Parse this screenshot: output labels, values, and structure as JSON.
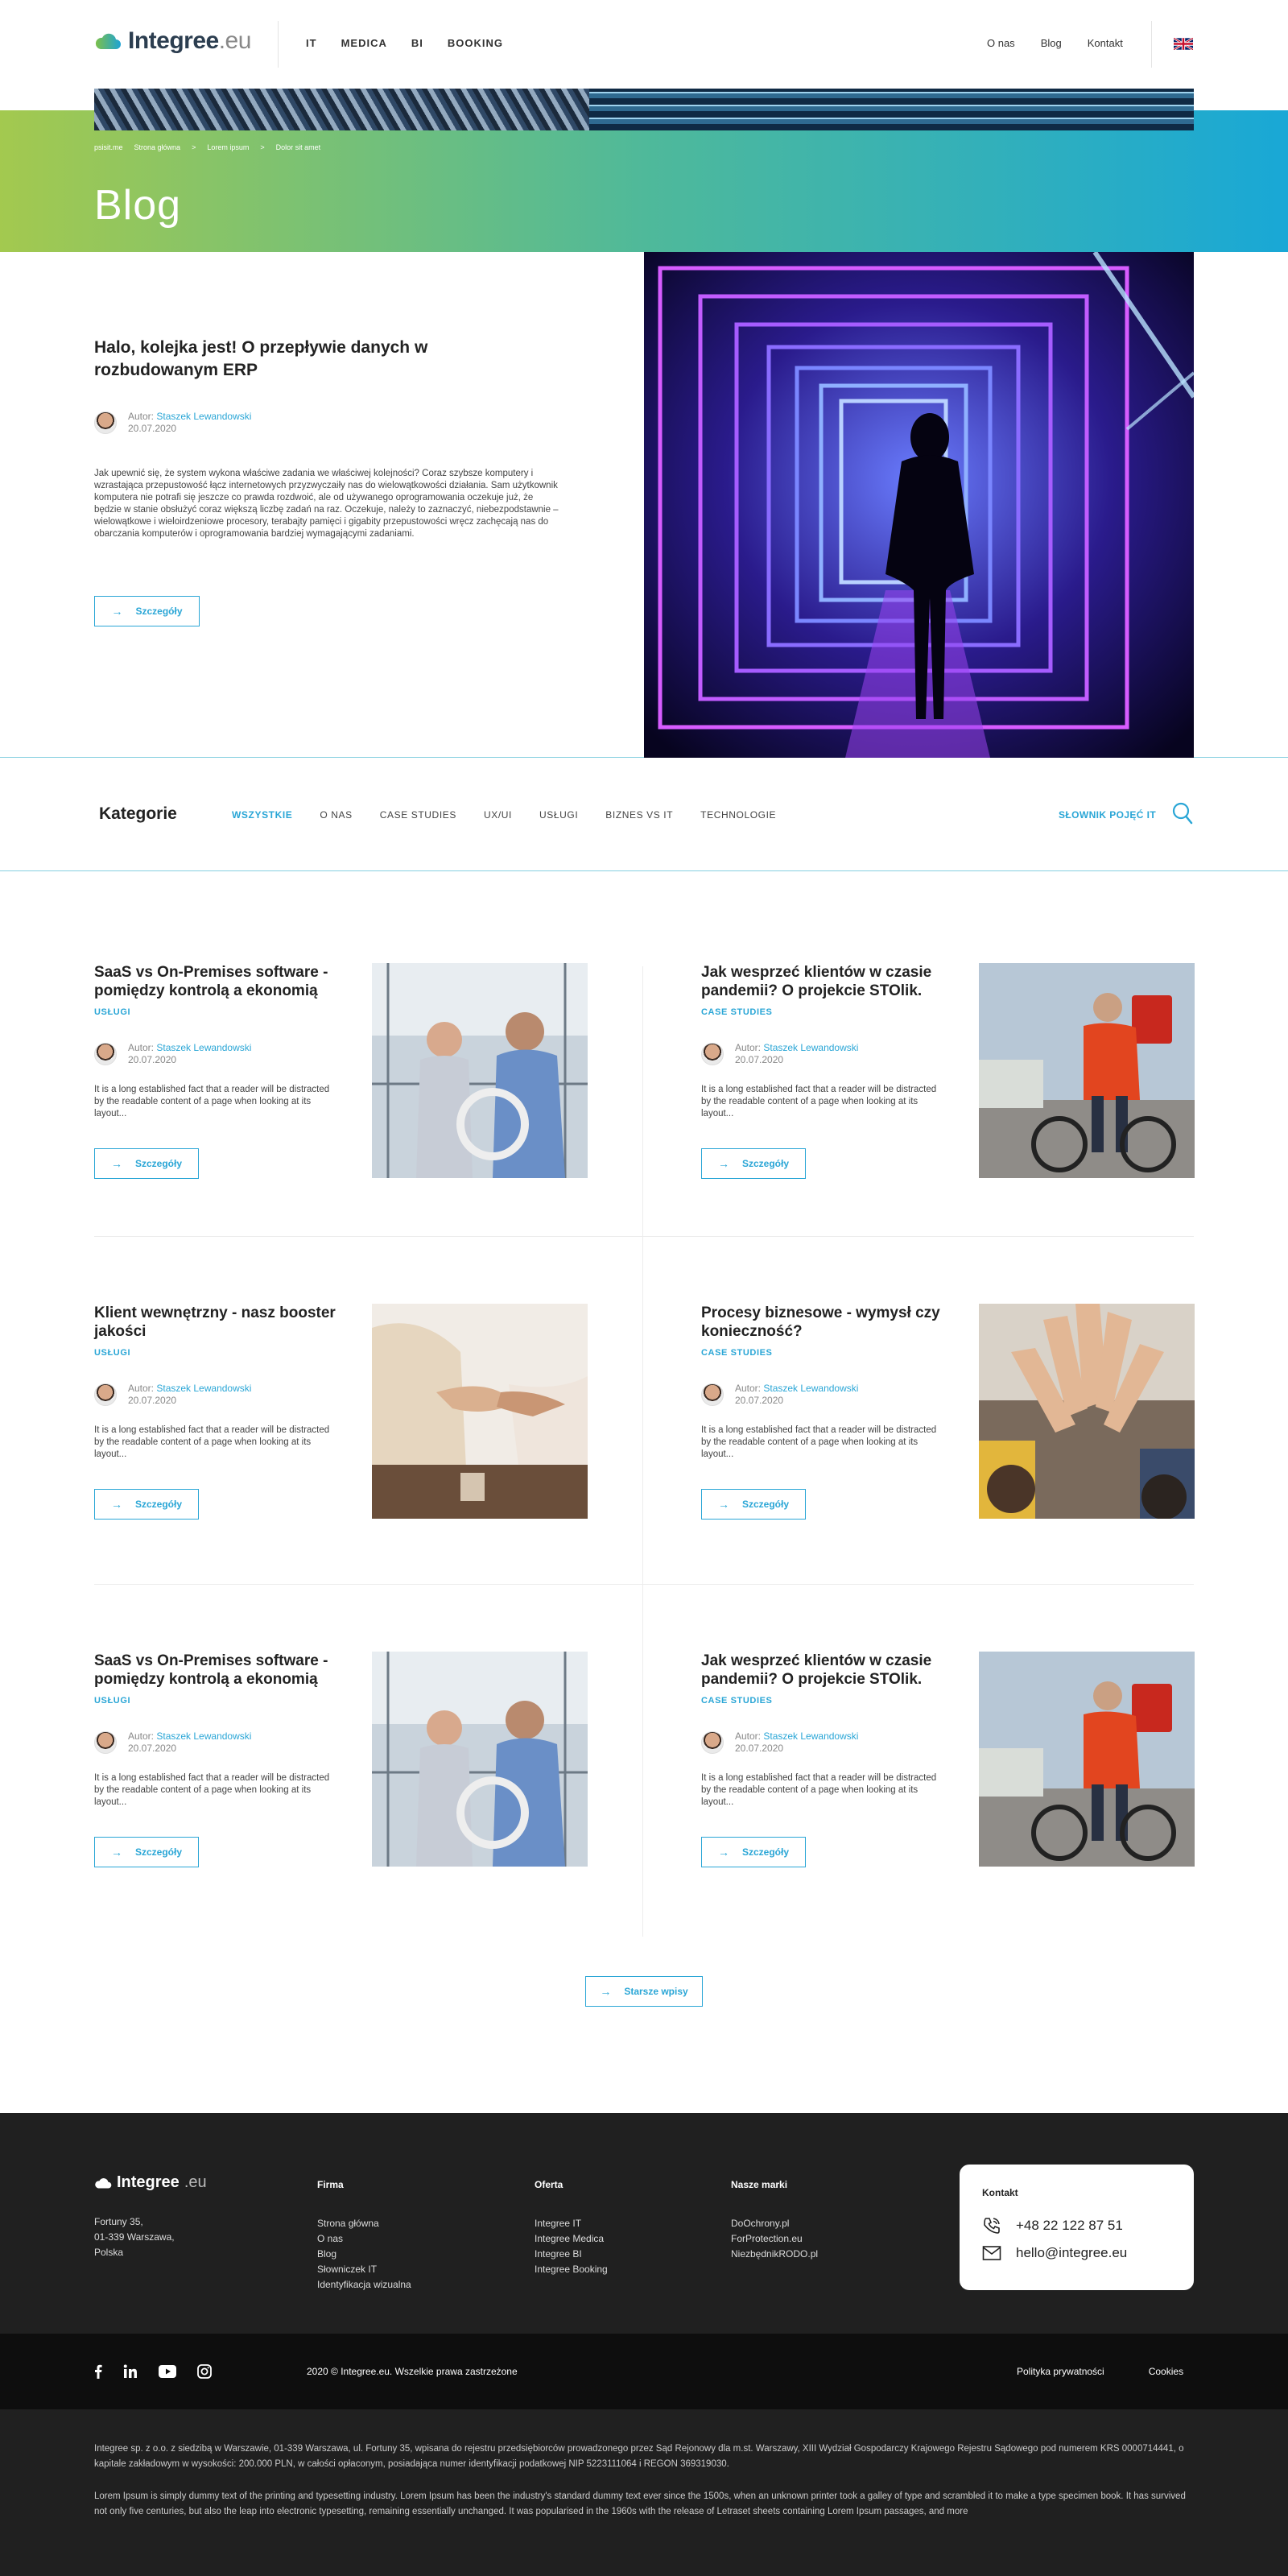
{
  "header": {
    "logo_brand": "Integree",
    "logo_tld": ".eu",
    "nav_main": [
      "IT",
      "MEDICA",
      "BI",
      "BOOKING"
    ],
    "nav_secondary": [
      "O nas",
      "Blog",
      "Kontakt"
    ],
    "language_icon": "uk-flag-icon"
  },
  "hero": {
    "breadcrumb": [
      "psisit.me",
      "Strona główna",
      ">",
      "Lorem ipsum",
      ">",
      "Dolor sit amet"
    ],
    "title": "Blog"
  },
  "featured": {
    "title": "Halo, kolejka jest! O przepływie danych w rozbudowanym ERP",
    "author_label": "Autor:",
    "author_name": "Staszek Lewandowski",
    "date": "20.07.2020",
    "excerpt": "Jak upewnić się, że system wykona właściwe zadania we właściwej kolejności? Coraz szybsze komputery i wzrastająca przepustowość łącz internetowych przyzwyczaiły nas do wielowątkowości działania. Sam użytkownik komputera nie potrafi się jeszcze co prawda rozdwoić, ale od używanego oprogramowania oczekuje już, że będzie w stanie obsłużyć coraz większą liczbę zadań na raz. Oczekuje, należy to zaznaczyć, niebezpodstawnie – wielowątkowe i wieloirdzeniowe procesory, terabajty pamięci i gigabity przepustowości wręcz zachęcają nas do obarczania komputerów i oprogramowania bardziej wymagającymi zadaniami.",
    "button": "Szczegóły"
  },
  "categories": {
    "title": "Kategorie",
    "tabs": [
      "WSZYSTKIE",
      "O NAS",
      "CASE STUDIES",
      "UX/UI",
      "USŁUGI",
      "BIZNES VS IT",
      "TECHNOLOGIE"
    ],
    "active_index": 0,
    "glossary": "SŁOWNIK POJĘĆ IT"
  },
  "posts": [
    {
      "title": "SaaS vs On-Premises software - pomiędzy kontrolą a ekonomią",
      "category": "USŁUGI",
      "author_label": "Autor:",
      "author_name": "Staszek Lewandowski",
      "date": "20.07.2020",
      "excerpt": "It is a long established fact that a reader will be distracted by the readable content of a page when looking at its layout...",
      "button": "Szczegóły",
      "image": "office-team-photo"
    },
    {
      "title": "Jak wesprzeć klientów w czasie pandemii? O projekcie STOlik.",
      "category": "CASE STUDIES",
      "author_label": "Autor:",
      "author_name": "Staszek Lewandowski",
      "date": "20.07.2020",
      "excerpt": "It is a long established fact that a reader will be distracted by the readable content of a page when looking at its layout...",
      "button": "Szczegóły",
      "image": "courier-bike-photo"
    },
    {
      "title": "Klient wewnętrzny - nasz booster jakości",
      "category": "USŁUGI",
      "author_label": "Autor:",
      "author_name": "Staszek Lewandowski",
      "date": "20.07.2020",
      "excerpt": "It is a long established fact that a reader will be distracted by the readable content of a page when looking at its layout...",
      "button": "Szczegóły",
      "image": "handshake-photo"
    },
    {
      "title": "Procesy biznesowe - wymysł czy konieczność?",
      "category": "CASE STUDIES",
      "author_label": "Autor:",
      "author_name": "Staszek Lewandowski",
      "date": "20.07.2020",
      "excerpt": "It is a long established fact that a reader will be distracted by the readable content of a page when looking at its layout...",
      "button": "Szczegóły",
      "image": "high-five-photo"
    },
    {
      "title": "SaaS vs On-Premises software - pomiędzy kontrolą a ekonomią",
      "category": "USŁUGI",
      "author_label": "Autor:",
      "author_name": "Staszek Lewandowski",
      "date": "20.07.2020",
      "excerpt": "It is a long established fact that a reader will be distracted by the readable content of a page when looking at its layout...",
      "button": "Szczegóły",
      "image": "office-team-photo"
    },
    {
      "title": "Jak wesprzeć klientów w czasie pandemii? O projekcie STOlik.",
      "category": "CASE STUDIES",
      "author_label": "Autor:",
      "author_name": "Staszek Lewandowski",
      "date": "20.07.2020",
      "excerpt": "It is a long established fact that a reader will be distracted by the readable content of a page when looking at its layout...",
      "button": "Szczegóły",
      "image": "courier-bike-photo"
    }
  ],
  "older_button": "Starsze wpisy",
  "footer": {
    "logo_brand": "Integree",
    "logo_tld": ".eu",
    "address": [
      "Fortuny 35,",
      "01-339 Warszawa,",
      "Polska"
    ],
    "columns": [
      {
        "title": "Firma",
        "links": [
          "Strona główna",
          "O nas",
          "Blog",
          "Słowniczek IT",
          "Identyfikacja wizualna"
        ]
      },
      {
        "title": "Oferta",
        "links": [
          "Integree IT",
          "Integree Medica",
          "Integree BI",
          "Integree Booking"
        ]
      },
      {
        "title": "Nasze marki",
        "links": [
          "DoOchrony.pl",
          "ForProtection.eu",
          "NiezbędnikRODO.pl"
        ]
      }
    ],
    "contact": {
      "title": "Kontakt",
      "phone": "+48 22 122 87 51",
      "email": "hello@integree.eu"
    },
    "socials": [
      "facebook-icon",
      "linkedin-icon",
      "youtube-icon",
      "instagram-icon"
    ],
    "copyright": "2020 © Integree.eu. Wszelkie prawa zastrzeżone",
    "legal_links": [
      "Polityka prywatności",
      "Cookies"
    ],
    "legal_text_1": "Integree sp. z o.o. z siedzibą w Warszawie, 01-339 Warszawa, ul. Fortuny 35, wpisana do rejestru przedsiębiorców prowadzonego przez Sąd Rejonowy dla m.st. Warszawy, XIII Wydział Gospodarczy Krajowego Rejestru Sądowego pod numerem KRS 0000714441, o kapitale zakładowym w wysokości: 200.000 PLN, w całości opłaconym, posiadająca numer identyfikacji podatkowej NIP 5223111064 i REGON 369319030.",
    "legal_text_2": "Lorem Ipsum is simply dummy text of the printing and typesetting industry. Lorem Ipsum has been the industry's standard dummy text ever since the 1500s, when an unknown printer took a galley of type and scrambled it to make a type specimen book. It has survived not only five centuries, but also the leap into electronic typesetting, remaining essentially unchanged. It was popularised in the 1960s with the release of Letraset sheets containing Lorem Ipsum passages, and more"
  },
  "colors": {
    "accent": "#2aa6d6",
    "gradient_start": "#a3c94f",
    "gradient_end": "#19a8d6",
    "footer_bg": "#202020"
  }
}
